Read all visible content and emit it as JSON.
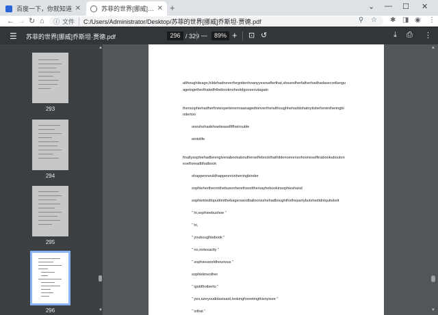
{
  "browser": {
    "tabs": [
      {
        "title": "百度一下，你就知道",
        "active": false,
        "favicon_color": "#2b63d9"
      },
      {
        "title": "苏菲的世界[挪威]乔斯坦·贾德.pdf",
        "active": true,
        "favicon_color": "#5f6368"
      }
    ],
    "new_tab_glyph": "+",
    "window_controls": [
      "⌄",
      "—",
      "☐",
      "✕"
    ],
    "nav": {
      "back": "←",
      "forward": "→",
      "reload": "↻",
      "home": "⌂"
    },
    "omnibox": {
      "info_icon": "ⓘ",
      "scheme_label": "文件",
      "url": "C:/Users/Administrator/Desktop/苏菲的世界[挪威]乔斯坦·贾德.pdf"
    }
  },
  "pdf_toolbar": {
    "menu_glyph": "☰",
    "doc_title": "苏菲的世界[挪威]乔斯坦·贾德.pdf",
    "current_page": "296",
    "total_pages": "/ 329",
    "zoom_out": "—",
    "zoom": "89%",
    "zoom_in": "+",
    "fit_glyph": "⊡",
    "rotate_glyph": "↺",
    "download_glyph": "⤓",
    "print_glyph": "⎙",
    "more_glyph": "⋮"
  },
  "thumbnails": [
    {
      "label": "293",
      "current": false
    },
    {
      "label": "294",
      "current": false
    },
    {
      "label": "295",
      "current": false
    },
    {
      "label": "296",
      "current": true
    }
  ],
  "page_text": [
    "althoughiteago,hildehadneverforgottenhoanyyearsafterthat,sheandherfatherhadhadasecretlangu",
    "agetogetherthatedhthebooknoheoldgooseoutagain",
    "thensophiehadherfirstexperienerinaanagedtonvertheralthoughhehaddohatnytisbeforeintheringbi",
    "ndertoo",
    "oneshehadehoeiteaselftfhetrouble",
    "eintolife",
    "finallysophiehadbeengivenabookaboutherselfebookthathildenoevensohooneselfinabookabouton",
    "eselforeadtthatbook",
    "ohappennouldhappennoinherringbinder",
    "sophiehertheronthebusonherefroootthersayhebookinsophieshand",
    "sophietriedtoputitintthebagersandballoonsshehadboughtforthepartybutshedidntquitekeit",
    "“ hi,sophieebushoe ”",
    "“ hi,",
    "“ youboughtabook ”",
    "“ no,notexactly ”",
    "“ sophiesworldhourious ”",
    "sophiekneother",
    "“ igotitfroiberto ”",
    "“ yes,iureyoudidasisaid,lookingforeetingthisnyisee ”",
    "“ isthat ”"
  ]
}
